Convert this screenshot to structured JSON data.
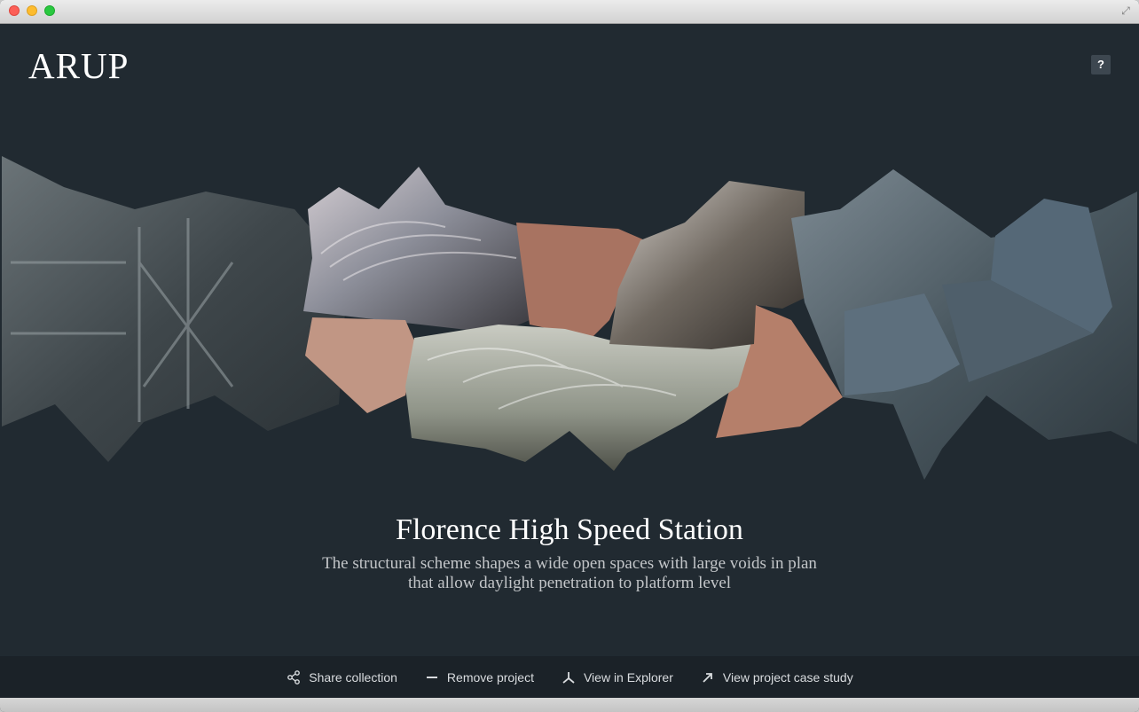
{
  "window": {
    "controls": [
      "close",
      "minimize",
      "zoom"
    ],
    "fullscreen_icon": "fullscreen-icon"
  },
  "header": {
    "logo_text": "ARUP",
    "help_label": "?"
  },
  "project": {
    "title": "Florence High Speed Station",
    "description_line1": "The structural scheme shapes a wide open spaces with large voids in plan",
    "description_line2": "that allow daylight penetration to platform level"
  },
  "actions": [
    {
      "label": "Share collection",
      "icon": "share-icon"
    },
    {
      "label": "Remove project",
      "icon": "minus-icon"
    },
    {
      "label": "View in Explorer",
      "icon": "explorer-icon"
    },
    {
      "label": "View project case study",
      "icon": "arrow-up-right-icon"
    }
  ],
  "colors": {
    "background": "#212a31",
    "bottom_bar": "#1b2228",
    "accent_copper": "#b57f6a",
    "accent_slate": "#56697a"
  }
}
